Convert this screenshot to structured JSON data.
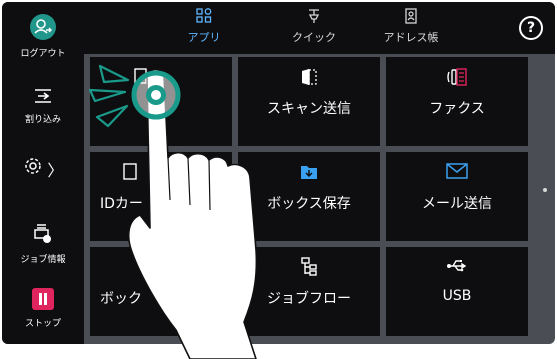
{
  "rail": {
    "logout_label": "ログアウト",
    "interrupt_label": "割り込み",
    "settings_chevron": "〉",
    "job_info_label": "ジョブ情報",
    "stop_label": "ストップ"
  },
  "tabs": [
    {
      "label": "アプリ",
      "active": true,
      "icon": "apps-grid-icon"
    },
    {
      "label": "クイック",
      "active": false,
      "icon": "quick-icon"
    },
    {
      "label": "アドレス帳",
      "active": false,
      "icon": "address-book-icon"
    }
  ],
  "help_label": "?",
  "tiles": [
    {
      "label": "",
      "icon": "copy-icon"
    },
    {
      "label": "スキャン送信",
      "icon": "scan-send-icon"
    },
    {
      "label": "ファクス",
      "icon": "fax-icon"
    },
    {
      "label": "IDカー",
      "icon": "id-card-copy-icon"
    },
    {
      "label": "ボックス保存",
      "icon": "box-save-icon"
    },
    {
      "label": "メール送信",
      "icon": "mail-send-icon"
    },
    {
      "label": "ボック",
      "icon": "box-operation-icon"
    },
    {
      "label": "ジョブフロー",
      "icon": "job-flow-icon"
    },
    {
      "label": "USB",
      "icon": "usb-icon"
    }
  ],
  "colors": {
    "accent": "#5fb6ff",
    "logout_green": "#21968a",
    "stop_red": "#e0245e",
    "tap_marker": "#1a9a8a"
  }
}
